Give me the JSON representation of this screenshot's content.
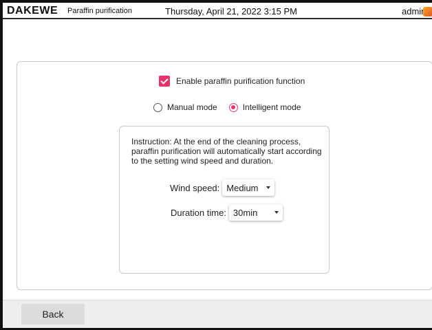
{
  "header": {
    "logo": "DAKEWE",
    "page_title": "Paraffin purification",
    "datetime": "Thursday, April 21, 2022  3:15 PM",
    "user": "admin"
  },
  "settings": {
    "enable_label": "Enable paraffin purification function",
    "enable_checked": true,
    "modes": [
      {
        "label": "Manual mode",
        "selected": false
      },
      {
        "label": "Intelligent mode",
        "selected": true
      }
    ],
    "instruction": "Instruction: At the end of the cleaning process, paraffin purification will automatically start according to the setting wind speed and duration.",
    "wind_speed": {
      "label": "Wind speed:",
      "value": "Medium"
    },
    "duration": {
      "label": "Duration time:",
      "value": "30min"
    }
  },
  "footer": {
    "back_label": "Back"
  },
  "colors": {
    "accent": "#e8336a",
    "bottom_bar": "#eeeeee"
  }
}
